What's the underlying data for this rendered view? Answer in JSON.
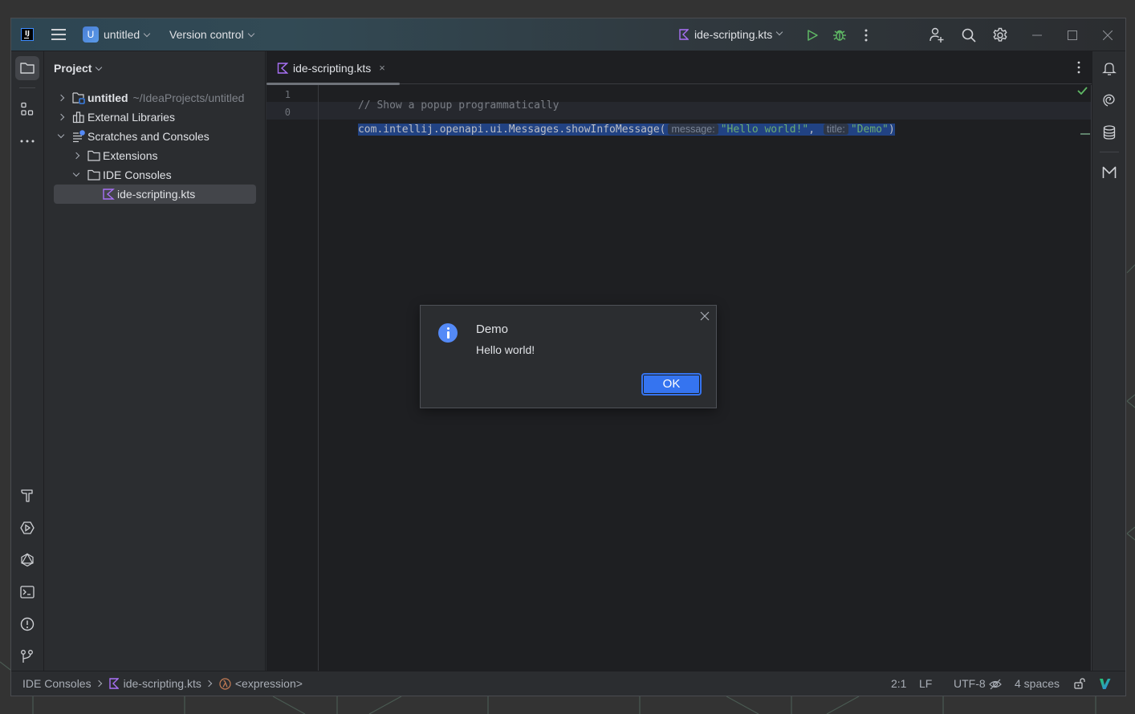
{
  "titlebar": {
    "project_initial": "U",
    "project_name": "untitled",
    "version_control": "Version control",
    "run_config": "ide-scripting.kts"
  },
  "project_panel": {
    "title": "Project",
    "tree": [
      {
        "label": "untitled",
        "path": "~/IdeaProjects/untitled",
        "expanded": false
      },
      {
        "label": "External Libraries",
        "expanded": false
      },
      {
        "label": "Scratches and Consoles",
        "expanded": true
      },
      {
        "label": "Extensions",
        "expanded": false
      },
      {
        "label": "IDE Consoles",
        "expanded": true
      },
      {
        "label": "ide-scripting.kts",
        "selected": true
      }
    ]
  },
  "editor": {
    "tab_label": "ide-scripting.kts",
    "tab_close": "×",
    "lines": [
      {
        "number": "1",
        "comment": "// Show a popup programmatically"
      },
      {
        "number": "0",
        "code_prefix": "com.intellij.openapi.ui.Messages.showInfoMessage(",
        "hint1": "message:",
        "arg1": "\"Hello world!\"",
        "sep": ", ",
        "hint2": "title:",
        "arg2": "\"Demo\"",
        "suffix": ")"
      }
    ]
  },
  "dialog": {
    "title": "Demo",
    "message": "Hello world!",
    "ok_label": "OK"
  },
  "statusbar": {
    "breadcrumbs": [
      "IDE Consoles",
      "ide-scripting.kts",
      "<expression>"
    ],
    "position": "2:1",
    "line_ending": "LF",
    "encoding": "UTF-8",
    "indent": "4 spaces"
  },
  "colors": {
    "accent": "#3574f0",
    "selection": "#214283",
    "string": "#6aab73",
    "kotlin_icon": "#a971f7",
    "run_green": "#5fb865",
    "info_icon": "#548af7"
  }
}
